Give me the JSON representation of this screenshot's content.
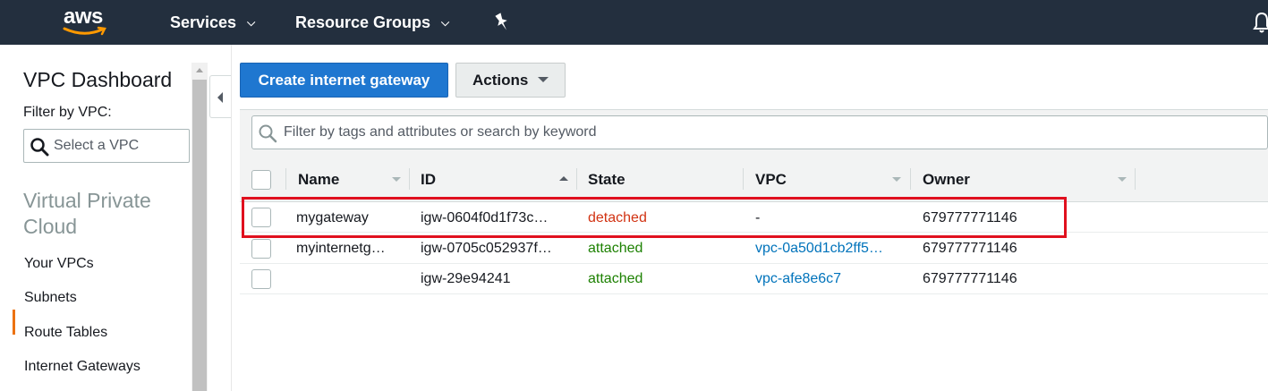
{
  "topnav": {
    "logo_text": "aws",
    "services_label": "Services",
    "resource_groups_label": "Resource Groups"
  },
  "sidebar": {
    "title": "VPC Dashboard",
    "filter_label": "Filter by VPC:",
    "select_placeholder": "Select a VPC",
    "section_title": "Virtual Private Cloud",
    "links": [
      "Your VPCs",
      "Subnets",
      "Route Tables",
      "Internet Gateways"
    ],
    "active_link": "Internet Gateways"
  },
  "toolbar": {
    "create_label": "Create internet gateway",
    "actions_label": "Actions"
  },
  "search": {
    "placeholder": "Filter by tags and attributes or search by keyword"
  },
  "table": {
    "columns": [
      "Name",
      "ID",
      "State",
      "VPC",
      "Owner"
    ],
    "sorted_column": "ID",
    "rows": [
      {
        "name": "mygateway",
        "id": "igw-0604f0d1f73c…",
        "state": "detached",
        "vpc": "-",
        "owner": "679777771146"
      },
      {
        "name": "myinternetg…",
        "id": "igw-0705c052937f…",
        "state": "attached",
        "vpc": "vpc-0a50d1cb2ff5…",
        "owner": "679777771146"
      },
      {
        "name": "",
        "id": "igw-29e94241",
        "state": "attached",
        "vpc": "vpc-afe8e6c7",
        "owner": "679777771146"
      }
    ]
  },
  "colors": {
    "nav_bg": "#232f3e",
    "primary": "#1f77d0",
    "detached": "#d13212",
    "attached": "#1d8102",
    "link": "#0073bb",
    "highlight": "#e0101e",
    "active_accent": "#ec7211"
  }
}
